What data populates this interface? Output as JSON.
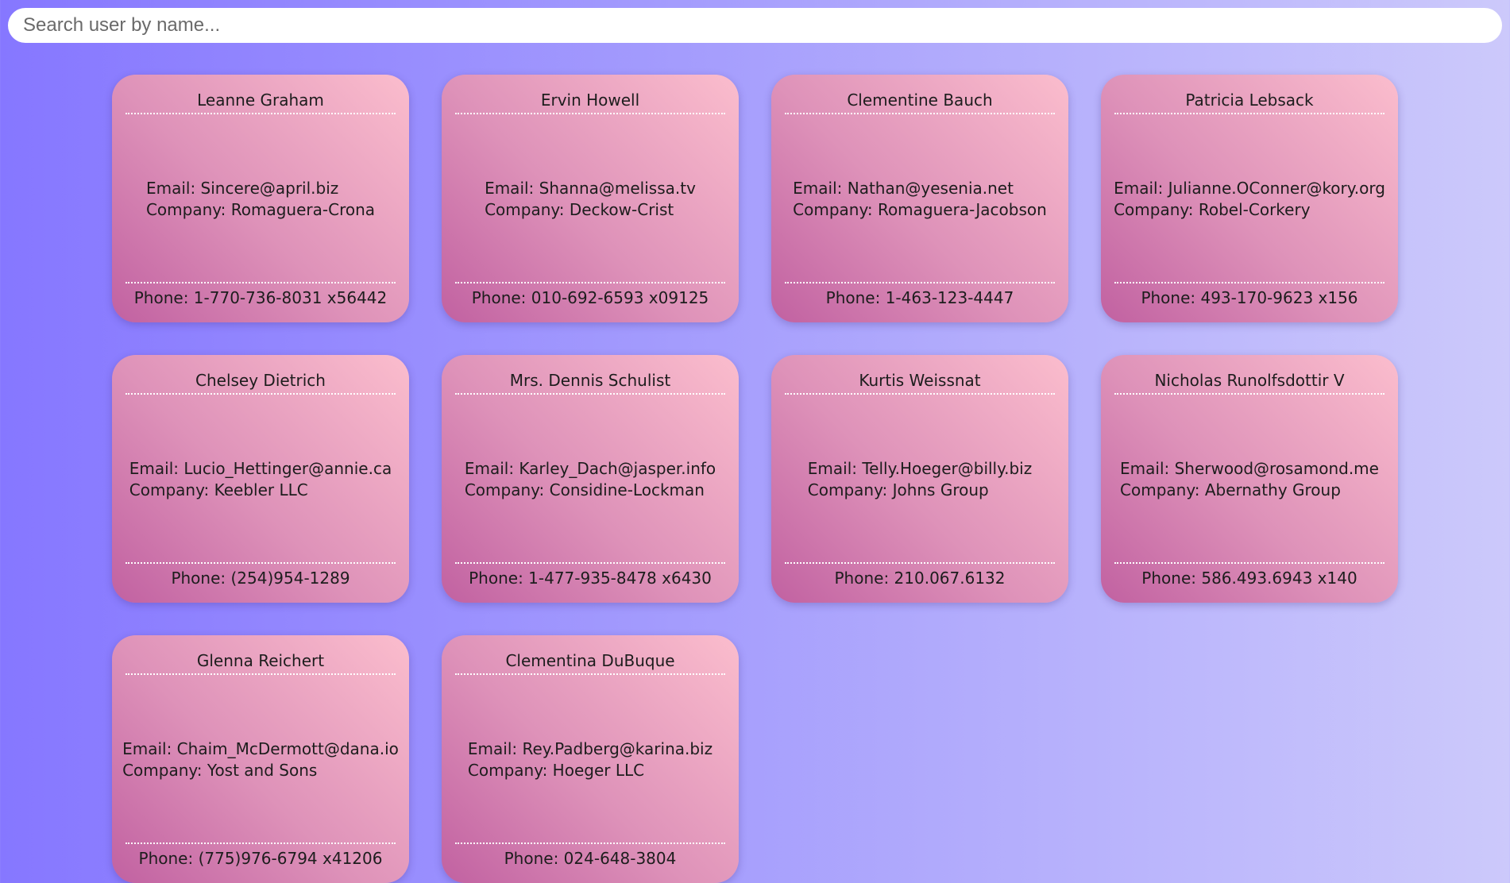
{
  "search": {
    "placeholder": "Search user by name...",
    "value": ""
  },
  "users": [
    {
      "name": "Leanne Graham",
      "email": "Email: Sincere@april.biz",
      "company": "Company: Romaguera-Crona",
      "phone": "Phone: 1-770-736-8031 x56442"
    },
    {
      "name": "Ervin Howell",
      "email": "Email: Shanna@melissa.tv",
      "company": "Company: Deckow-Crist",
      "phone": "Phone: 010-692-6593 x09125"
    },
    {
      "name": "Clementine Bauch",
      "email": "Email: Nathan@yesenia.net",
      "company": "Company: Romaguera-Jacobson",
      "phone": "Phone: 1-463-123-4447"
    },
    {
      "name": "Patricia Lebsack",
      "email": "Email: Julianne.OConner@kory.org",
      "company": "Company: Robel-Corkery",
      "phone": "Phone: 493-170-9623 x156"
    },
    {
      "name": "Chelsey Dietrich",
      "email": "Email: Lucio_Hettinger@annie.ca",
      "company": "Company: Keebler LLC",
      "phone": "Phone: (254)954-1289"
    },
    {
      "name": "Mrs. Dennis Schulist",
      "email": "Email: Karley_Dach@jasper.info",
      "company": "Company: Considine-Lockman",
      "phone": "Phone: 1-477-935-8478 x6430"
    },
    {
      "name": "Kurtis Weissnat",
      "email": "Email: Telly.Hoeger@billy.biz",
      "company": "Company: Johns Group",
      "phone": "Phone: 210.067.6132"
    },
    {
      "name": "Nicholas Runolfsdottir V",
      "email": "Email: Sherwood@rosamond.me",
      "company": "Company: Abernathy Group",
      "phone": "Phone: 586.493.6943 x140"
    },
    {
      "name": "Glenna Reichert",
      "email": "Email: Chaim_McDermott@dana.io",
      "company": "Company: Yost and Sons",
      "phone": "Phone: (775)976-6794 x41206"
    },
    {
      "name": "Clementina DuBuque",
      "email": "Email: Rey.Padberg@karina.biz",
      "company": "Company: Hoeger LLC",
      "phone": "Phone: 024-648-3804"
    }
  ]
}
